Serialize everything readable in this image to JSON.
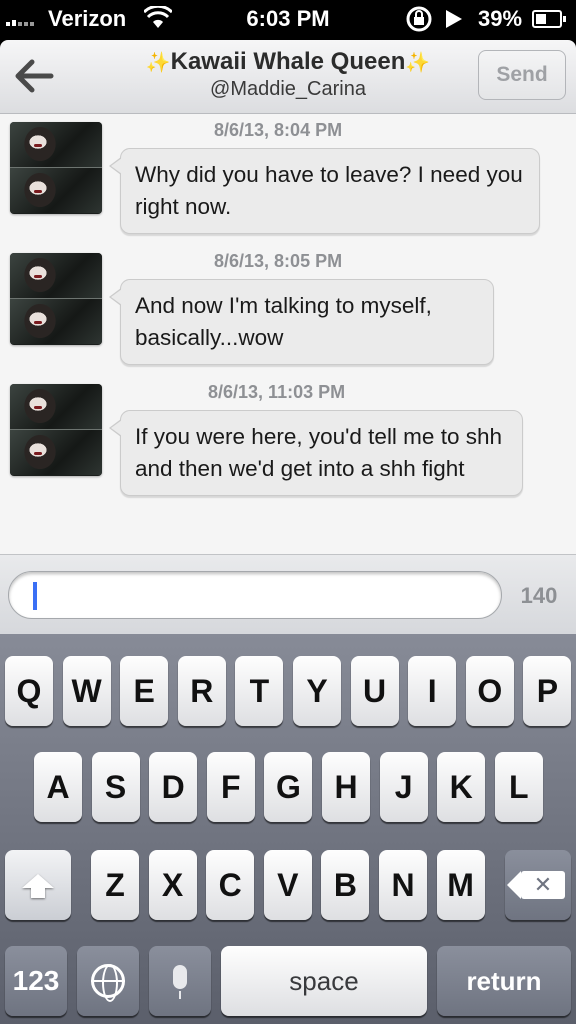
{
  "status_bar": {
    "carrier": "Verizon",
    "time": "6:03 PM",
    "battery": "39%",
    "icons": [
      "signal-bars-icon",
      "wifi-icon",
      "rotation-lock-icon",
      "play-icon",
      "battery-icon"
    ]
  },
  "nav": {
    "back_icon": "back-arrow-icon",
    "title_sparkle": "✨",
    "title": "Kawaii Whale Queen",
    "subtitle": "@Maddie_Carina",
    "send_label": "Send"
  },
  "messages": [
    {
      "timestamp": "8/6/13, 8:04 PM",
      "text": "Why did you have to leave? I need you right now."
    },
    {
      "timestamp": "8/6/13, 8:05 PM",
      "text": "And now I'm talking to myself, basically...wow"
    },
    {
      "timestamp": "8/6/13, 11:03 PM",
      "text": "If you were here, you'd tell me to shh and then we'd get into a shh fight"
    }
  ],
  "compose": {
    "value": "",
    "char_count": "140"
  },
  "keyboard": {
    "row1": [
      "Q",
      "W",
      "E",
      "R",
      "T",
      "Y",
      "U",
      "I",
      "O",
      "P"
    ],
    "row2": [
      "A",
      "S",
      "D",
      "F",
      "G",
      "H",
      "J",
      "K",
      "L"
    ],
    "row3": [
      "Z",
      "X",
      "C",
      "V",
      "B",
      "N",
      "M"
    ],
    "numbers_label": "123",
    "space_label": "space",
    "return_label": "return",
    "icons": [
      "shift-icon",
      "backspace-icon",
      "globe-icon",
      "microphone-icon"
    ]
  }
}
